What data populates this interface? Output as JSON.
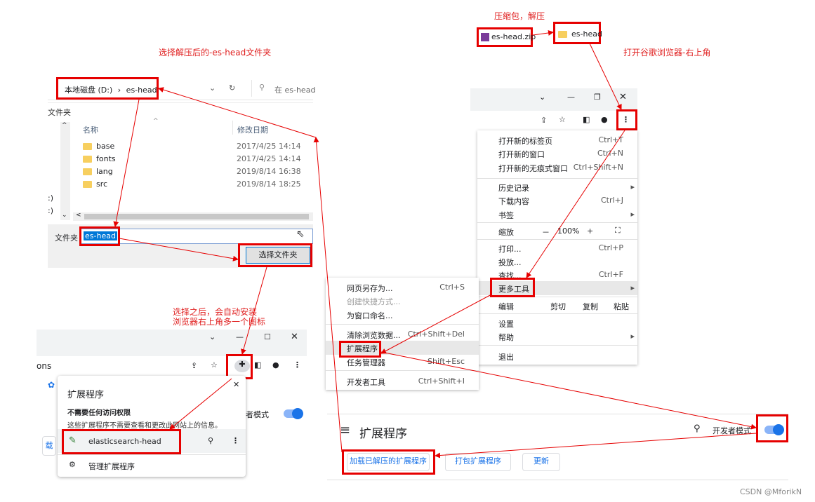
{
  "annotations": {
    "compress": "压缩包，解压",
    "open_chrome": "打开谷歌浏览器-右上角",
    "select_folder": "选择解压后的-es-head文件夹",
    "after_select_1": "选择之后，会自动安装",
    "after_select_2": "浏览器右上角多一个图标"
  },
  "archive": {
    "zip": "es-head.zip",
    "folder": "es-head"
  },
  "explorer": {
    "breadcrumb_drive": "本地磁盘 (D:)",
    "breadcrumb_sep": "›",
    "breadcrumb_folder": "es-head",
    "search_placeholder": "在 es-head",
    "left_label": "文件夹",
    "col_name": "名称",
    "col_date": "修改日期",
    "files": [
      {
        "name": "base",
        "date": "2017/4/25 14:14"
      },
      {
        "name": "fonts",
        "date": "2017/4/25 14:14"
      },
      {
        "name": "lang",
        "date": "2019/8/14 16:38"
      },
      {
        "name": "src",
        "date": "2019/8/14 18:25"
      }
    ],
    "side1": ":)",
    "side2": ":)",
    "folder_label": "文件夹",
    "folder_value": "es-head",
    "select_button": "选择文件夹"
  },
  "chrome_menu": {
    "items1": [
      {
        "label": "打开新的标签页",
        "shortcut": "Ctrl+T"
      },
      {
        "label": "打开新的窗口",
        "shortcut": "Ctrl+N"
      },
      {
        "label": "打开新的无痕式窗口",
        "shortcut": "Ctrl+Shift+N"
      }
    ],
    "history": "历史记录",
    "downloads": "下载内容",
    "downloads_shortcut": "Ctrl+J",
    "bookmarks": "书签",
    "zoom": "缩放",
    "zoom_minus": "－",
    "zoom_value": "100%",
    "zoom_plus": "+",
    "print": "打印...",
    "print_shortcut": "Ctrl+P",
    "cast": "投放...",
    "find": "查找...",
    "find_shortcut": "Ctrl+F",
    "more_tools": "更多工具",
    "edit": "编辑",
    "cut": "剪切",
    "copy": "复制",
    "paste": "粘贴",
    "settings": "设置",
    "help": "帮助",
    "exit": "退出"
  },
  "submenu": {
    "save_as": "网页另存为...",
    "save_as_shortcut": "Ctrl+S",
    "create_shortcut": "创建快捷方式...",
    "name_window": "为窗口命名...",
    "clear_data": "清除浏览数据...",
    "clear_data_shortcut": "Ctrl+Shift+Del",
    "extensions": "扩展程序",
    "task_manager": "任务管理器",
    "task_manager_shortcut": "Shift+Esc",
    "dev_tools": "开发者工具",
    "dev_tools_shortcut": "Ctrl+Shift+I"
  },
  "ext_page": {
    "title": "扩展程序",
    "dev_mode": "开发者模式",
    "load_unpacked": "加载已解压的扩展程序",
    "pack": "打包扩展程序",
    "update": "更新"
  },
  "ext_popup": {
    "url_fragment": "ons",
    "title": "扩展程序",
    "no_access_title": "不需要任何访问权限",
    "no_access_desc": "这些扩展程序不需要查看和更改此网站上的信息。",
    "ext_name": "elasticsearch-head",
    "manage": "管理扩展程序",
    "dev_mode_partial": "者模式",
    "side_btn": "载"
  },
  "watermark": "CSDN @MforikN",
  "colors": {
    "annotation": "#e60000",
    "accent": "#1a73e8"
  }
}
